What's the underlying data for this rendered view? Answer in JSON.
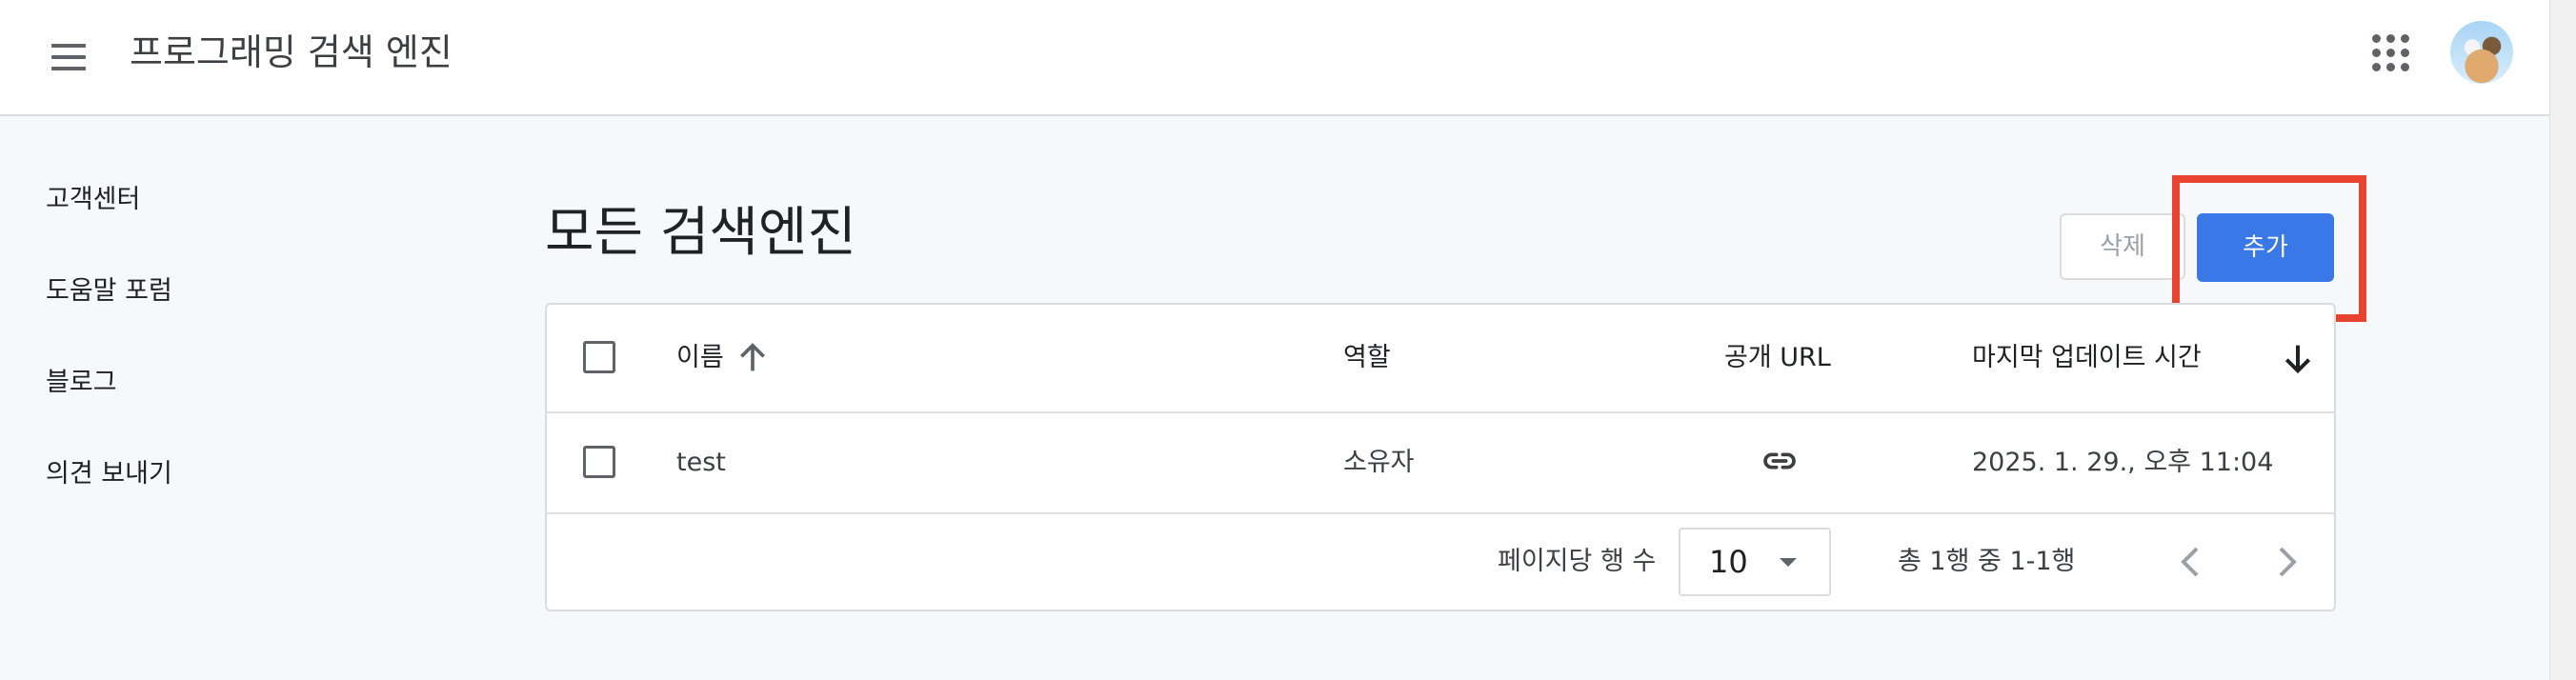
{
  "header": {
    "title": "프로그래밍 검색 엔진",
    "menu_icon": "hamburger-menu-icon",
    "apps_icon": "apps-grid-icon",
    "avatar_icon": "user-avatar"
  },
  "sidebar": {
    "items": [
      {
        "label": "고객센터"
      },
      {
        "label": "도움말 포럼"
      },
      {
        "label": "블로그"
      },
      {
        "label": "의견 보내기"
      }
    ]
  },
  "main": {
    "title": "모든 검색엔진",
    "delete_label": "삭제",
    "add_label": "추가"
  },
  "table": {
    "columns": {
      "name": "이름",
      "role": "역할",
      "public_url": "공개 URL",
      "last_updated": "마지막 업데이트 시간"
    },
    "rows": [
      {
        "name": "test",
        "role": "소유자",
        "public_url_icon": "link-icon",
        "last_updated": "2025. 1. 29., 오후 11:04"
      }
    ],
    "footer": {
      "rows_per_page_label": "페이지당 행 수",
      "rows_per_page_value": "10",
      "range_text": "총 1행 중 1-1행"
    }
  },
  "colors": {
    "primary": "#3b78e7",
    "link": "#1a73e8",
    "highlight": "#e8432e",
    "background": "#f7f8f9"
  }
}
